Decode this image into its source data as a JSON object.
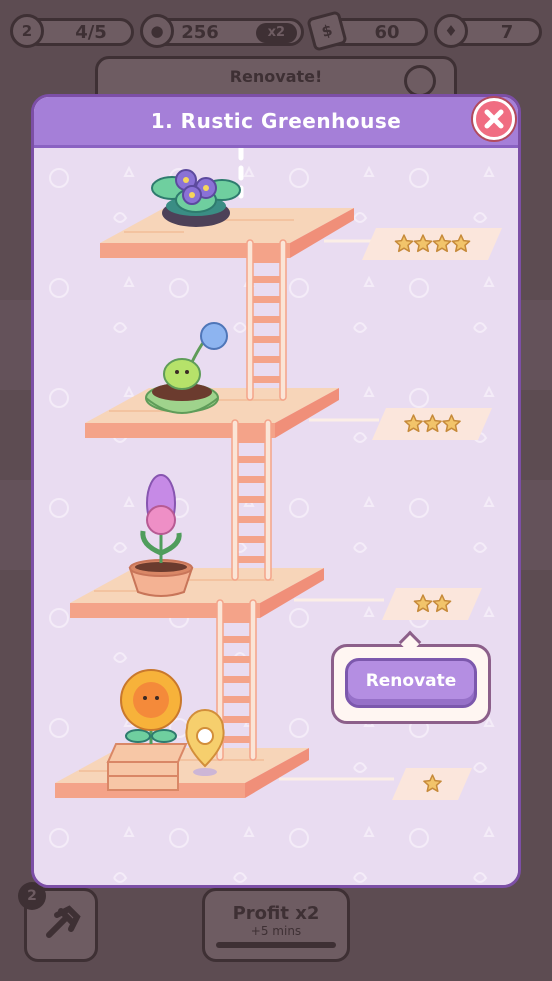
{
  "hud": {
    "level": "2",
    "level_progress": "4/5",
    "coins": "256",
    "coins_multiplier": "x2",
    "cash": "60",
    "gems": "7"
  },
  "background": {
    "renovate_tab_label": "Renovate!",
    "tool_badge": "2",
    "profit_title": "Profit x2",
    "profit_subtitle": "+5 mins"
  },
  "modal": {
    "title": "1. Rustic Greenhouse",
    "levels": [
      {
        "plant": "violet",
        "stars": 4
      },
      {
        "plant": "sprout",
        "stars": 3
      },
      {
        "plant": "hyacinth",
        "stars": 2
      },
      {
        "plant": "sunflower",
        "stars": 1
      }
    ],
    "renovate_label": "Renovate"
  },
  "colors": {
    "accent": "#a57fd8",
    "platform": "#f7c7a6",
    "star": "#f2c46a",
    "close": "#f06d82"
  }
}
